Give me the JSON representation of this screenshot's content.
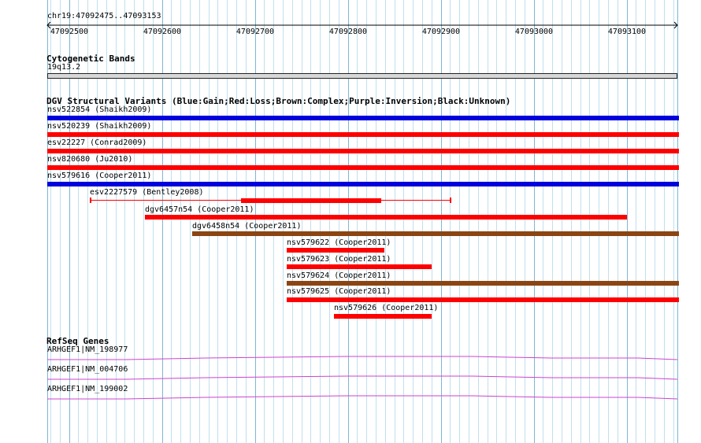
{
  "location": "chr19:47092475..47093153",
  "ruler": {
    "ticks": [
      "47092500",
      "47092600",
      "47092700",
      "47092800",
      "47092900",
      "47093000",
      "47093100"
    ]
  },
  "cyto": {
    "title": "Cytogenetic Bands",
    "band": "19q13.2"
  },
  "dgv": {
    "title": "DGV Structural Variants (Blue:Gain;Red:Loss;Brown:Complex;Purple:Inversion;Black:Unknown)",
    "colors": {
      "gain": "#0000dd",
      "loss": "#ff0000",
      "complex": "#8b4513"
    },
    "features": [
      {
        "label": "nsv522854 (Shaikh2009)",
        "type": "gain"
      },
      {
        "label": "nsv520239 (Shaikh2009)",
        "type": "loss"
      },
      {
        "label": "esv22227 (Conrad2009)",
        "type": "loss"
      },
      {
        "label": "nsv820680 (Ju2010)",
        "type": "loss"
      },
      {
        "label": "nsv579616 (Cooper2011)",
        "type": "gain"
      },
      {
        "label": "esv2227579 (Bentley2008)",
        "type": "loss"
      },
      {
        "label": "dgv6457n54 (Cooper2011)",
        "type": "loss"
      },
      {
        "label": "dgv6458n54 (Cooper2011)",
        "type": "complex"
      },
      {
        "label": "nsv579622 (Cooper2011)",
        "type": "loss"
      },
      {
        "label": "nsv579623 (Cooper2011)",
        "type": "loss"
      },
      {
        "label": "nsv579624 (Cooper2011)",
        "type": "complex"
      },
      {
        "label": "nsv579625 (Cooper2011)",
        "type": "loss"
      },
      {
        "label": "nsv579626 (Cooper2011)",
        "type": "loss"
      }
    ]
  },
  "refseq": {
    "title": "RefSeq Genes",
    "color": "#cc44cc",
    "genes": [
      {
        "label": "ARHGEF1|NM_198977"
      },
      {
        "label": "ARHGEF1|NM_004706"
      },
      {
        "label": "ARHGEF1|NM_199002"
      }
    ]
  }
}
